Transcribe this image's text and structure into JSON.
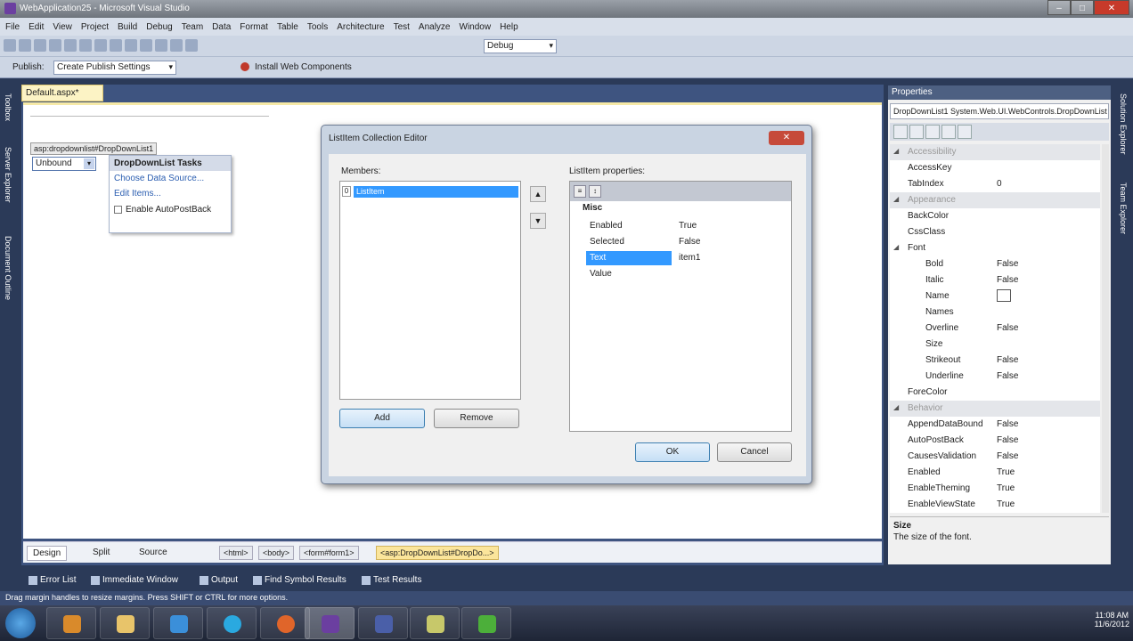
{
  "window": {
    "title": "WebApplication25 - Microsoft Visual Studio",
    "buttons": {
      "minimize": "–",
      "maximize": "□",
      "close": "✕"
    }
  },
  "menu": [
    "File",
    "Edit",
    "View",
    "Project",
    "Build",
    "Debug",
    "Team",
    "Data",
    "Format",
    "Table",
    "Tools",
    "Architecture",
    "Test",
    "Analyze",
    "Window",
    "Help"
  ],
  "toolbar": {
    "config": "Debug",
    "publish_label": "Publish:",
    "publish_profile": "Create Publish Settings",
    "install_label": "Install Web Components"
  },
  "left_tool_windows": [
    "Toolbox",
    "Server Explorer",
    "Document Outline"
  ],
  "right_tool_windows": [
    "Solution Explorer",
    "Team Explorer"
  ],
  "editor": {
    "tab_label": "Default.aspx*",
    "smart_tag_label": "asp:dropdownlist#DropDownList1",
    "dropdown_value": "Unbound",
    "tasks": {
      "header": "DropDownList Tasks",
      "choose_data_source": "Choose Data Source...",
      "edit_items": "Edit Items...",
      "autopostback": "Enable AutoPostBack"
    },
    "views": {
      "design": "Design",
      "split": "Split",
      "source": "Source"
    },
    "breadcrumbs": [
      "<html>",
      "<body>",
      "<form#form1>",
      "<asp:DropDownList#DropDo...>"
    ]
  },
  "dialog": {
    "title": "ListItem Collection Editor",
    "close": "✕",
    "members_label": "Members:",
    "members": [
      {
        "index": "0",
        "text": "ListItem"
      }
    ],
    "add": "Add",
    "remove": "Remove",
    "properties_label": "ListItem properties:",
    "category": "Misc",
    "properties": [
      {
        "name": "Enabled",
        "value": "True"
      },
      {
        "name": "Selected",
        "value": "False"
      },
      {
        "name": "Text",
        "value": "item1"
      },
      {
        "name": "Value",
        "value": ""
      }
    ],
    "ok": "OK",
    "cancel": "Cancel"
  },
  "properties_panel": {
    "header": "Properties",
    "selected_object": "DropDownList1  System.Web.UI.WebControls.DropDownList",
    "rows": [
      {
        "type": "cat",
        "name": "Accessibility"
      },
      {
        "name": "AccessKey",
        "value": ""
      },
      {
        "name": "TabIndex",
        "value": "0"
      },
      {
        "type": "cat",
        "name": "Appearance"
      },
      {
        "name": "BackColor",
        "value": ""
      },
      {
        "name": "CssClass",
        "value": ""
      },
      {
        "type": "group",
        "name": "Font",
        "value": ""
      },
      {
        "name": "Bold",
        "value": "False",
        "indent": true
      },
      {
        "name": "Italic",
        "value": "False",
        "indent": true
      },
      {
        "name": "Name",
        "value": "",
        "indent": true,
        "box": true
      },
      {
        "name": "Names",
        "value": "",
        "indent": true
      },
      {
        "name": "Overline",
        "value": "False",
        "indent": true
      },
      {
        "name": "Size",
        "value": "",
        "indent": true
      },
      {
        "name": "Strikeout",
        "value": "False",
        "indent": true
      },
      {
        "name": "Underline",
        "value": "False",
        "indent": true
      },
      {
        "name": "ForeColor",
        "value": ""
      },
      {
        "type": "cat",
        "name": "Behavior"
      },
      {
        "name": "AppendDataBound",
        "value": "False"
      },
      {
        "name": "AutoPostBack",
        "value": "False"
      },
      {
        "name": "CausesValidation",
        "value": "False"
      },
      {
        "name": "Enabled",
        "value": "True"
      },
      {
        "name": "EnableTheming",
        "value": "True"
      },
      {
        "name": "EnableViewState",
        "value": "True"
      }
    ],
    "desc_title": "Size",
    "desc_text": "The size of the font."
  },
  "output_tabs": [
    "Error List",
    "Immediate Window",
    "Output",
    "Find Symbol Results",
    "Test Results"
  ],
  "status_text": "Drag margin handles to resize margins. Press SHIFT or CTRL for more options.",
  "clock": {
    "time": "11:08 AM",
    "date": "11/6/2012"
  }
}
